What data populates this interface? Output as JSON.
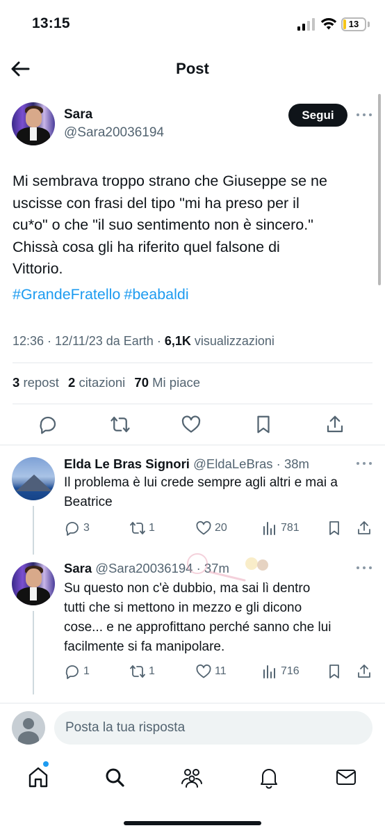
{
  "status_bar": {
    "time": "13:15",
    "battery": "13",
    "battery_level": 0.13,
    "battery_color": "#f5c518"
  },
  "header": {
    "title": "Post"
  },
  "post": {
    "author_name": "Sara",
    "author_handle": "@Sara20036194",
    "follow_label": "Segui",
    "text_lines": [
      "Mi sembrava troppo strano che Giuseppe se ne",
      "uscisse con frasi del tipo \"mi ha preso per il",
      "cu*o\" o che \"il suo sentimento non è sincero.\"",
      "Chissà cosa gli ha riferito quel falsone di",
      "Vittorio."
    ],
    "hashtags": [
      "#GrandeFratello",
      "#beabaldi"
    ],
    "meta_prefix": "12:36 · 12/11/23 da Earth · ",
    "views_count": "6,1K",
    "views_label": "visualizzazioni",
    "stats": {
      "reposts_count": "3",
      "reposts_label": "repost",
      "quotes_count": "2",
      "quotes_label": "citazioni",
      "likes_count": "70",
      "likes_label": "Mi piace"
    }
  },
  "replies": [
    {
      "name": "Elda Le Bras Signori",
      "handle": "@EldaLeBras · 38m",
      "text_lines": [
        "Il problema è lui crede sempre agli altri e mai a",
        "Beatrice"
      ],
      "replies": "3",
      "reposts": "1",
      "likes": "20",
      "views": "781"
    },
    {
      "name": "Sara",
      "handle": "@Sara20036194 · 37m",
      "text_lines": [
        "Su questo non c'è dubbio, ma sai lì dentro",
        "tutti che si mettono in mezzo e gli dicono",
        "cose... e ne approfittano perché sanno che lui",
        "facilmente si fa manipolare."
      ],
      "replies": "1",
      "reposts": "1",
      "likes": "11",
      "views": "716"
    }
  ],
  "compose": {
    "placeholder": "Posta la tua risposta"
  },
  "colors": {
    "accent": "#1d9bf0",
    "text": "#0f1419",
    "muted": "#536471"
  },
  "tabbar": {
    "items": [
      "home-icon",
      "search-icon",
      "communities-icon",
      "notifications-icon",
      "messages-icon"
    ]
  }
}
